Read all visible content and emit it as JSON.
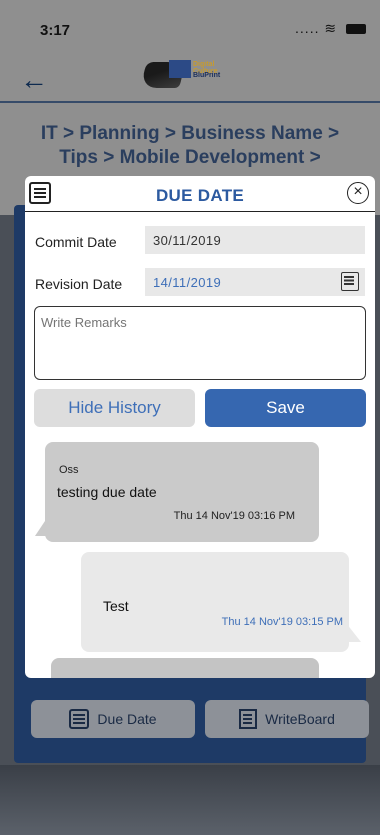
{
  "status_bar": {
    "time": "3:17",
    "signal": "....."
  },
  "header": {
    "logo_top": "Digital Culture",
    "logo_bottom": "BluPrint",
    "breadcrumb": "IT > Planning > Business Name > Tips > Mobile Development >"
  },
  "modal": {
    "title": "DUE DATE",
    "commit_label": "Commit Date",
    "commit_value": "30/11/2019",
    "revision_label": "Revision Date",
    "revision_value": "14/11/2019",
    "remarks_placeholder": "Write Remarks",
    "hide_history_label": "Hide History",
    "save_label": "Save"
  },
  "history": [
    {
      "author": "Oss",
      "message": "testing due date",
      "timestamp": "Thu 14 Nov'19 03:16 PM"
    },
    {
      "author": "",
      "message": "Test",
      "timestamp": "Thu 14 Nov'19 03:15 PM"
    }
  ],
  "bottom": {
    "due_date_label": "Due Date",
    "writeboard_label": "WriteBoard"
  },
  "colors": {
    "accent": "#3667b0",
    "panel": "#1e3a66"
  }
}
